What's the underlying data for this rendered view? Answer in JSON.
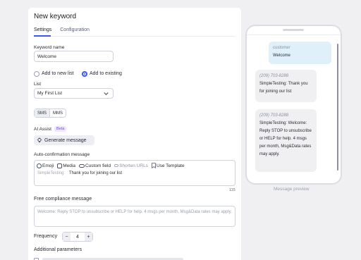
{
  "page": {
    "title": "New keyword"
  },
  "tabs": [
    {
      "label": "Settings",
      "active": true
    },
    {
      "label": "Configuration",
      "active": false
    }
  ],
  "keyword": {
    "label": "Keyword name",
    "value": "Welcome"
  },
  "list_mode": {
    "options": [
      "Add to new list",
      "Add to existing"
    ],
    "selected": "Add to existing"
  },
  "list": {
    "label": "List",
    "value": "My First List"
  },
  "channel": {
    "options": [
      "SMS",
      "MMS"
    ],
    "selected": "SMS"
  },
  "ai": {
    "label": "AI Assist",
    "badge": "Beta",
    "button": "Generate message"
  },
  "auto_confirmation": {
    "label": "Auto-confirmation message",
    "tools": [
      "Emoji",
      "Media",
      "Custom field",
      "Shorten URLs",
      "Use Template"
    ],
    "prefix": "SimpleTesting:",
    "message": "Thank you for joining our list",
    "counter": "115"
  },
  "compliance": {
    "label": "Free compliance message",
    "placeholder": "Welcome: Reply STOP to unsubscribe or HELP for help. 4 msgs per month, Msg&Data rates may apply."
  },
  "frequency": {
    "label": "Frequency",
    "value": "4",
    "minus": "−",
    "plus": "+"
  },
  "additional": {
    "label": "Additional parameters"
  },
  "preview": {
    "label": "Message preview",
    "messages": [
      {
        "from": "customer",
        "text": "Welcome"
      },
      {
        "from": "(209) 703-8288",
        "text": "SimpleTesting: Thank you for joining our list"
      },
      {
        "from": "(209) 703-8288",
        "text": "SimpleTesting: Welcome: Reply STOP to unsubscribe or HELP for help. 4 msgs per month, Msg&Data rates may apply."
      }
    ]
  },
  "colors": {
    "accent": "#3b54ff",
    "beta_bg": "#ece6ff",
    "beta_text": "#7051d6",
    "outgoing_bubble": "#dff0fb",
    "incoming_bubble": "#f0f0f3"
  }
}
